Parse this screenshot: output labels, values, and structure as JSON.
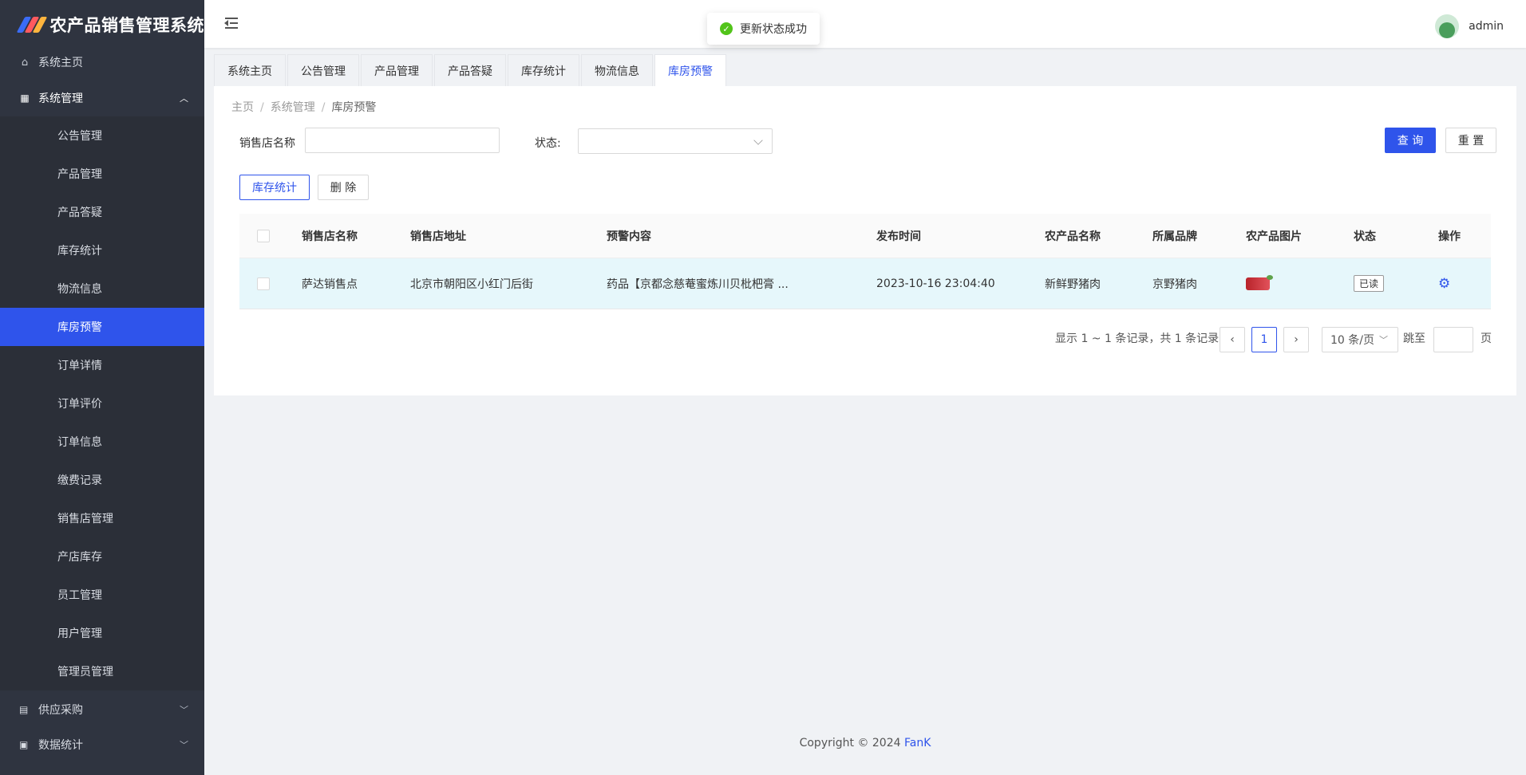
{
  "app": {
    "title": "农产品销售管理系统"
  },
  "colors": {
    "accent": "#2f54eb",
    "sidebar_bg": "#2f3440",
    "success": "#52c41a"
  },
  "sidebar": {
    "home": {
      "label": "系统主页",
      "icon": "home-icon"
    },
    "system_group": {
      "label": "系统管理",
      "icon": "grid-icon"
    },
    "items": [
      {
        "label": "公告管理"
      },
      {
        "label": "产品管理"
      },
      {
        "label": "产品答疑"
      },
      {
        "label": "库存统计"
      },
      {
        "label": "物流信息"
      },
      {
        "label": "库房预警",
        "active": true
      },
      {
        "label": "订单详情"
      },
      {
        "label": "订单评价"
      },
      {
        "label": "订单信息"
      },
      {
        "label": "缴费记录"
      },
      {
        "label": "销售店管理"
      },
      {
        "label": "产店库存"
      },
      {
        "label": "员工管理"
      },
      {
        "label": "用户管理"
      },
      {
        "label": "管理员管理"
      }
    ],
    "supply": {
      "label": "供应采购",
      "icon": "file-icon"
    },
    "stats": {
      "label": "数据统计",
      "icon": "chart-icon"
    }
  },
  "header": {
    "username": "admin"
  },
  "toast": {
    "message": "更新状态成功"
  },
  "tabs": [
    {
      "label": "系统主页"
    },
    {
      "label": "公告管理"
    },
    {
      "label": "产品管理"
    },
    {
      "label": "产品答疑"
    },
    {
      "label": "库存统计"
    },
    {
      "label": "物流信息"
    },
    {
      "label": "库房预警",
      "active": true
    }
  ],
  "breadcrumb": {
    "home": "主页",
    "parent": "系统管理",
    "current": "库房预警"
  },
  "search": {
    "store_label": "销售店名称",
    "store_value": "",
    "status_label": "状态:",
    "status_value": "",
    "query_button": "查 询",
    "reset_button": "重 置"
  },
  "actions": {
    "stock_button": "库存统计",
    "delete_button": "删 除"
  },
  "table": {
    "columns": [
      "销售店名称",
      "销售店地址",
      "预警内容",
      "发布时间",
      "农产品名称",
      "所属品牌",
      "农产品图片",
      "状态",
      "操作"
    ],
    "rows": [
      {
        "store": "萨达销售点",
        "address": "北京市朝阳区小红门后街",
        "content": "药品【京都念慈菴蜜炼川贝枇杷膏 ...",
        "time": "2023-10-16 23:04:40",
        "product": "新鲜野猪肉",
        "brand": "京野猪肉",
        "status": "已读"
      }
    ]
  },
  "pagination": {
    "summary": "显示 1 ~ 1 条记录，共 1 条记录",
    "current_page": "1",
    "page_size": "10 条/页",
    "jump_label": "跳至",
    "page_unit": "页"
  },
  "footer": {
    "text": "Copyright © 2024",
    "link": "FanK"
  }
}
